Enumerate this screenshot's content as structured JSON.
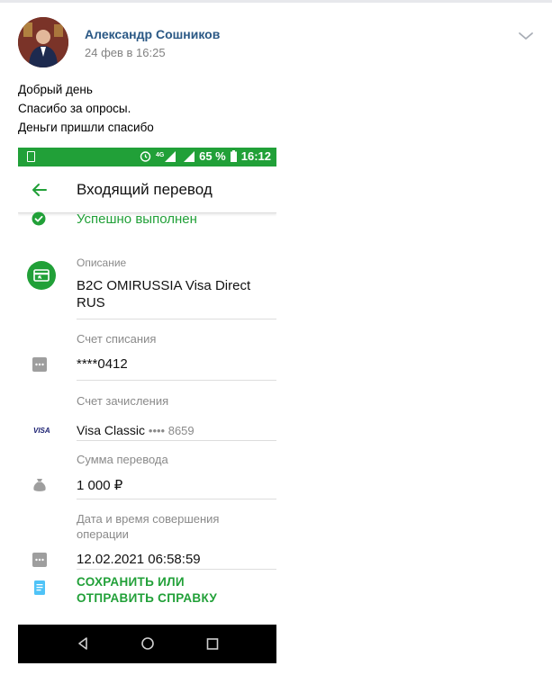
{
  "post": {
    "author_name": "Александр Сошников",
    "date": "24 фев в 16:25",
    "lines": [
      "Добрый день",
      "Спасибо за опросы.",
      "Деньги пришли спасибо"
    ]
  },
  "phone": {
    "status_bar": {
      "battery_percent": "65 %",
      "time": "16:12",
      "network": "4G"
    },
    "app_bar": {
      "title": "Входящий перевод"
    },
    "status": "Успешно выполнен",
    "description": {
      "label": "Описание",
      "line1": "B2C OMIRUSSIA Visa Direct",
      "line2": "RUS"
    },
    "debit_account": {
      "label": "Счет списания",
      "value": "****0412"
    },
    "credit_account": {
      "label": "Счет зачисления",
      "card_brand": "VISA",
      "card_name": "Visa Classic",
      "card_mask": "•••• 8659"
    },
    "amount": {
      "label": "Сумма перевода",
      "value": "1 000 ₽"
    },
    "datetime": {
      "label_line1": "Дата и время совершения",
      "label_line2": "операции",
      "value": "12.02.2021 06:58:59"
    },
    "save_action": {
      "line1": "СОХРАНИТЬ ИЛИ",
      "line2": "ОТПРАВИТЬ СПРАВКУ"
    }
  },
  "colors": {
    "link": "#2a5885",
    "sber_green": "#21a038",
    "muted": "#828282"
  }
}
